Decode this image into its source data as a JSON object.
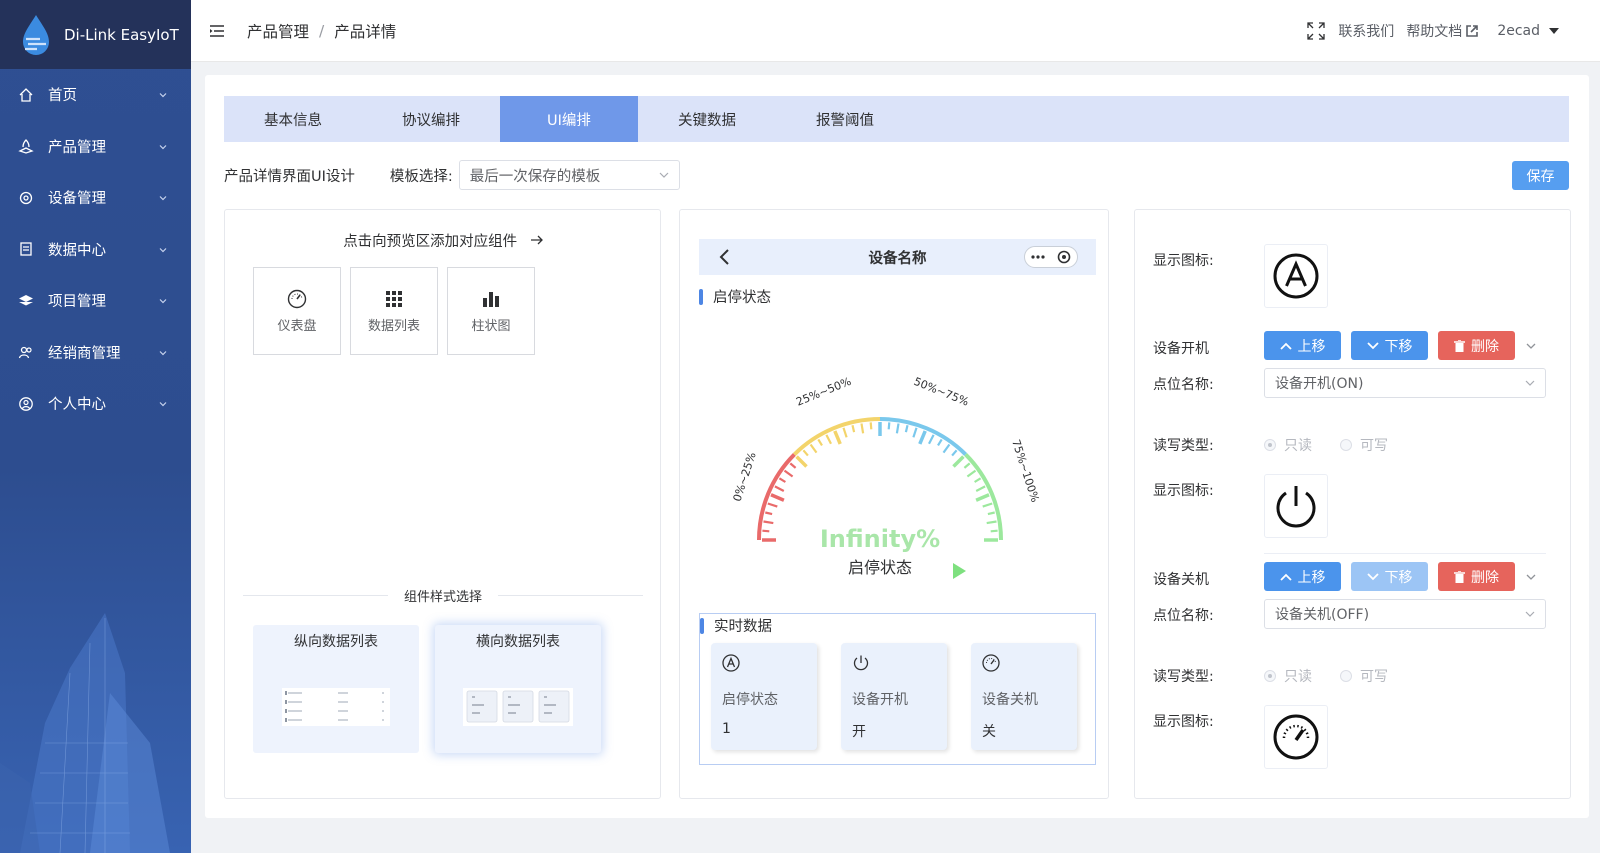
{
  "brand": {
    "name": "Di-Link EasyIoT"
  },
  "sidebar": {
    "items": [
      {
        "label": "首页",
        "icon": "home-icon"
      },
      {
        "label": "产品管理",
        "icon": "product-icon"
      },
      {
        "label": "设备管理",
        "icon": "device-icon"
      },
      {
        "label": "数据中心",
        "icon": "data-icon"
      },
      {
        "label": "项目管理",
        "icon": "project-icon"
      },
      {
        "label": "经销商管理",
        "icon": "dealer-icon"
      },
      {
        "label": "个人中心",
        "icon": "user-icon"
      }
    ]
  },
  "header": {
    "breadcrumb": [
      "产品管理",
      "产品详情"
    ],
    "separator": "/",
    "contact": "联系我们",
    "help": "帮助文档",
    "user": "2ecad"
  },
  "tabs": [
    {
      "label": "基本信息",
      "active": false
    },
    {
      "label": "协议编排",
      "active": false
    },
    {
      "label": "UI编排",
      "active": true
    },
    {
      "label": "关键数据",
      "active": false
    },
    {
      "label": "报警阈值",
      "active": false
    }
  ],
  "designer": {
    "title": "产品详情界面UI设计",
    "template_label": "模板选择:",
    "template_value": "最后一次保存的模板",
    "save": "保存"
  },
  "left_panel": {
    "hint": "点击向预览区添加对应组件",
    "components": [
      {
        "label": "仪表盘",
        "icon": "gauge-icon"
      },
      {
        "label": "数据列表",
        "icon": "grid-icon"
      },
      {
        "label": "柱状图",
        "icon": "bar-chart-icon"
      }
    ],
    "style_title": "组件样式选择",
    "styles": [
      {
        "label": "纵向数据列表",
        "selected": false
      },
      {
        "label": "横向数据列表",
        "selected": true
      }
    ]
  },
  "preview": {
    "device_name": "设备名称",
    "section1": "启停状态",
    "gauge": {
      "value_text": "Infinity%",
      "label": "启停状态",
      "segments": [
        "0%~25%",
        "25%~50%",
        "50%~75%",
        "75%~100%"
      ],
      "colors": [
        "#e96a6a",
        "#f3d46b",
        "#7ac8ec",
        "#9ce89d"
      ]
    },
    "section2": "实时数据",
    "realtime": [
      {
        "icon": "a-letter-icon",
        "label": "启停状态",
        "value": "1"
      },
      {
        "icon": "power-icon",
        "label": "设备开机",
        "value": "开"
      },
      {
        "icon": "gauge-icon",
        "label": "设备关机",
        "value": "关"
      }
    ]
  },
  "config": {
    "display_icon_label": "显示图标:",
    "point_label": "点位名称:",
    "rw_label": "读写类型:",
    "up": "上移",
    "down": "下移",
    "delete": "删除",
    "readonly": "只读",
    "writable": "可写",
    "items": [
      {
        "name": "设备开机",
        "point": "设备开机(ON)"
      },
      {
        "name": "设备关机",
        "point": "设备关机(OFF)"
      }
    ]
  }
}
